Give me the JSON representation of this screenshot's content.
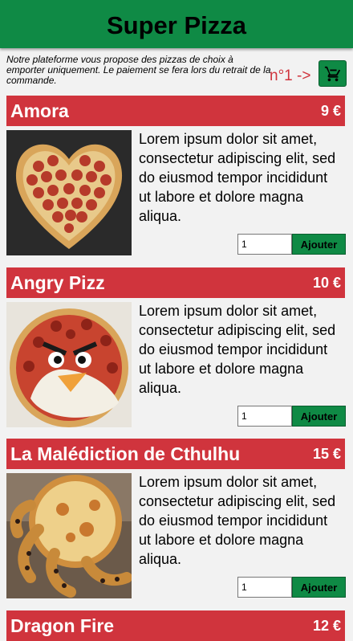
{
  "header": {
    "title": "Super Pizza"
  },
  "intro": {
    "text": "Notre plateforme vous propose des pizzas de choix à emporter uniquement. Le paiement se fera lors du retrait de la commande."
  },
  "rank_label": "n°1 ->",
  "cart": {
    "icon": "cart-icon"
  },
  "colors": {
    "green": "#0f8a45",
    "red": "#d0343d",
    "background": "#f2f2f2"
  },
  "pizzas": [
    {
      "name": "Amora",
      "price": "9 €",
      "description": "Lorem ipsum dolor sit amet, consectetur adipiscing elit, sed do eiusmod tempor incididunt ut labore et dolore magna aliqua.",
      "quantity": "1",
      "add_label": "Ajouter"
    },
    {
      "name": "Angry Pizz",
      "price": "10 €",
      "description": "Lorem ipsum dolor sit amet, consectetur adipiscing elit, sed do eiusmod tempor incididunt ut labore et dolore magna aliqua.",
      "quantity": "1",
      "add_label": "Ajouter"
    },
    {
      "name": "La Malédiction de Cthulhu",
      "price": "15 €",
      "description": "Lorem ipsum dolor sit amet, consectetur adipiscing elit, sed do eiusmod tempor incididunt ut labore et dolore magna aliqua.",
      "quantity": "1",
      "add_label": "Ajouter"
    },
    {
      "name": "Dragon Fire",
      "price": "12 €"
    }
  ]
}
